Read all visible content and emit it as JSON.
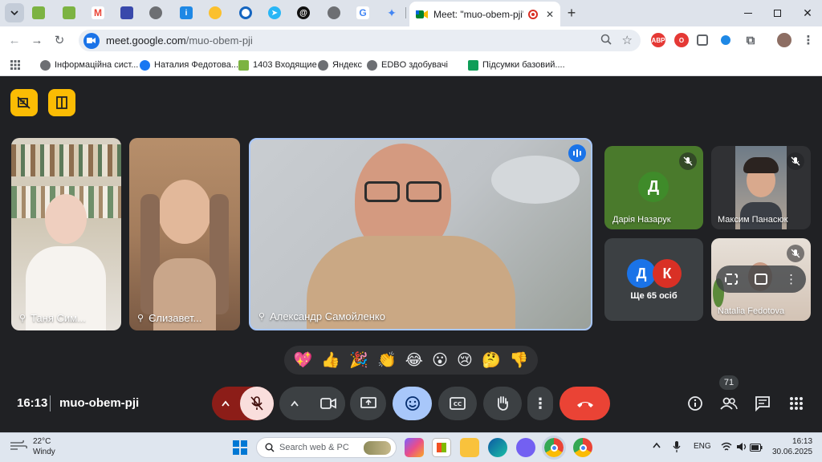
{
  "browser": {
    "active_tab_title": "Meet: \"muo-obem-pji\"",
    "new_tab_symbol": "+",
    "url_host": "meet.google.com",
    "url_path": "/muo-obem-pji",
    "ext_abp": "ABP",
    "bookmarks": [
      "Інформаційна сист...",
      "Наталия Федотова...",
      "1403 Входящие",
      "Яндекс",
      "EDBO здобувачі",
      "Підсумки базовий...."
    ],
    "accent": "#1a73e8"
  },
  "meet": {
    "participants": {
      "tile1": "Таня Сим...",
      "tile2": "Єлизавет...",
      "main": "Александр Самойленко",
      "daria_initial": "Д",
      "daria": "Дарія Назарук",
      "maksym": "Максим Панасюк",
      "others_initial_1": "Д",
      "others_initial_2": "К",
      "others": "Ще 65 осіб",
      "natalia": "Natalia Fedotova"
    },
    "reactions": [
      "💖",
      "👍",
      "🎉",
      "👏",
      "😂",
      "😮",
      "😢",
      "🤔",
      "👎"
    ],
    "time": "16:13",
    "meeting_code": "muo-obem-pji",
    "people_count": "71",
    "colors": {
      "yellow": "#fbbc04",
      "end_call": "#ea4335",
      "active_btn": "#a8c7fa",
      "green_tile": "#4a7a2c"
    }
  },
  "taskbar": {
    "weather_temp": "22°C",
    "weather_desc": "Windy",
    "search_placeholder": "Search web & PC",
    "lang": "ENG",
    "time": "16:13",
    "date": "30.06.2025"
  }
}
